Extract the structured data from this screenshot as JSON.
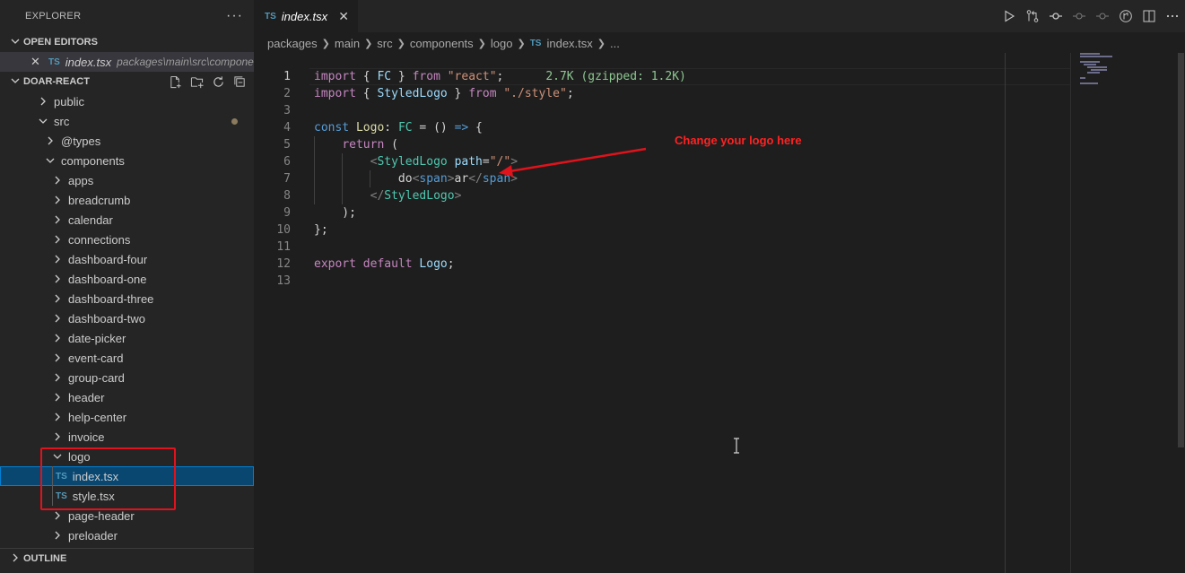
{
  "sidebar": {
    "title": "EXPLORER",
    "more": "···",
    "open_editors": {
      "header": "OPEN EDITORS",
      "item": {
        "close": "✕",
        "badge": "TS",
        "name": "index.tsx",
        "path": "packages\\main\\src\\compone..."
      }
    },
    "project": {
      "header": "DOAR-REACT",
      "rows": [
        {
          "label": "public",
          "badge": ""
        },
        {
          "label": "src",
          "badge": ""
        },
        {
          "label": "@types",
          "badge": ""
        },
        {
          "label": "components",
          "badge": ""
        },
        {
          "label": "apps",
          "badge": ""
        },
        {
          "label": "breadcrumb",
          "badge": ""
        },
        {
          "label": "calendar",
          "badge": ""
        },
        {
          "label": "connections",
          "badge": ""
        },
        {
          "label": "dashboard-four",
          "badge": ""
        },
        {
          "label": "dashboard-one",
          "badge": ""
        },
        {
          "label": "dashboard-three",
          "badge": ""
        },
        {
          "label": "dashboard-two",
          "badge": ""
        },
        {
          "label": "date-picker",
          "badge": ""
        },
        {
          "label": "event-card",
          "badge": ""
        },
        {
          "label": "group-card",
          "badge": ""
        },
        {
          "label": "header",
          "badge": ""
        },
        {
          "label": "help-center",
          "badge": ""
        },
        {
          "label": "invoice",
          "badge": ""
        },
        {
          "label": "logo",
          "badge": ""
        },
        {
          "label": "index.tsx",
          "badge": "TS"
        },
        {
          "label": "style.tsx",
          "badge": "TS"
        },
        {
          "label": "page-header",
          "badge": ""
        },
        {
          "label": "preloader",
          "badge": ""
        }
      ]
    },
    "outline_header": "OUTLINE"
  },
  "tabs": [
    {
      "badge": "TS",
      "name": "index.tsx",
      "close": "✕"
    }
  ],
  "breadcrumb": {
    "parts": [
      "packages",
      "main",
      "src",
      "components",
      "logo"
    ],
    "file_badge": "TS",
    "file": "index.tsx",
    "tail": "..."
  },
  "editor": {
    "line_numbers": [
      "1",
      "2",
      "3",
      "4",
      "5",
      "6",
      "7",
      "8",
      "9",
      "10",
      "11",
      "12",
      "13"
    ],
    "import_cost": "2.7K (gzipped: 1.2K)",
    "annotation": "Change your logo here"
  },
  "colors": {
    "annotation": "#ff2222",
    "selection_box": "#e0121b",
    "selected_row": "#094771",
    "ts_badge": "#519aba"
  }
}
